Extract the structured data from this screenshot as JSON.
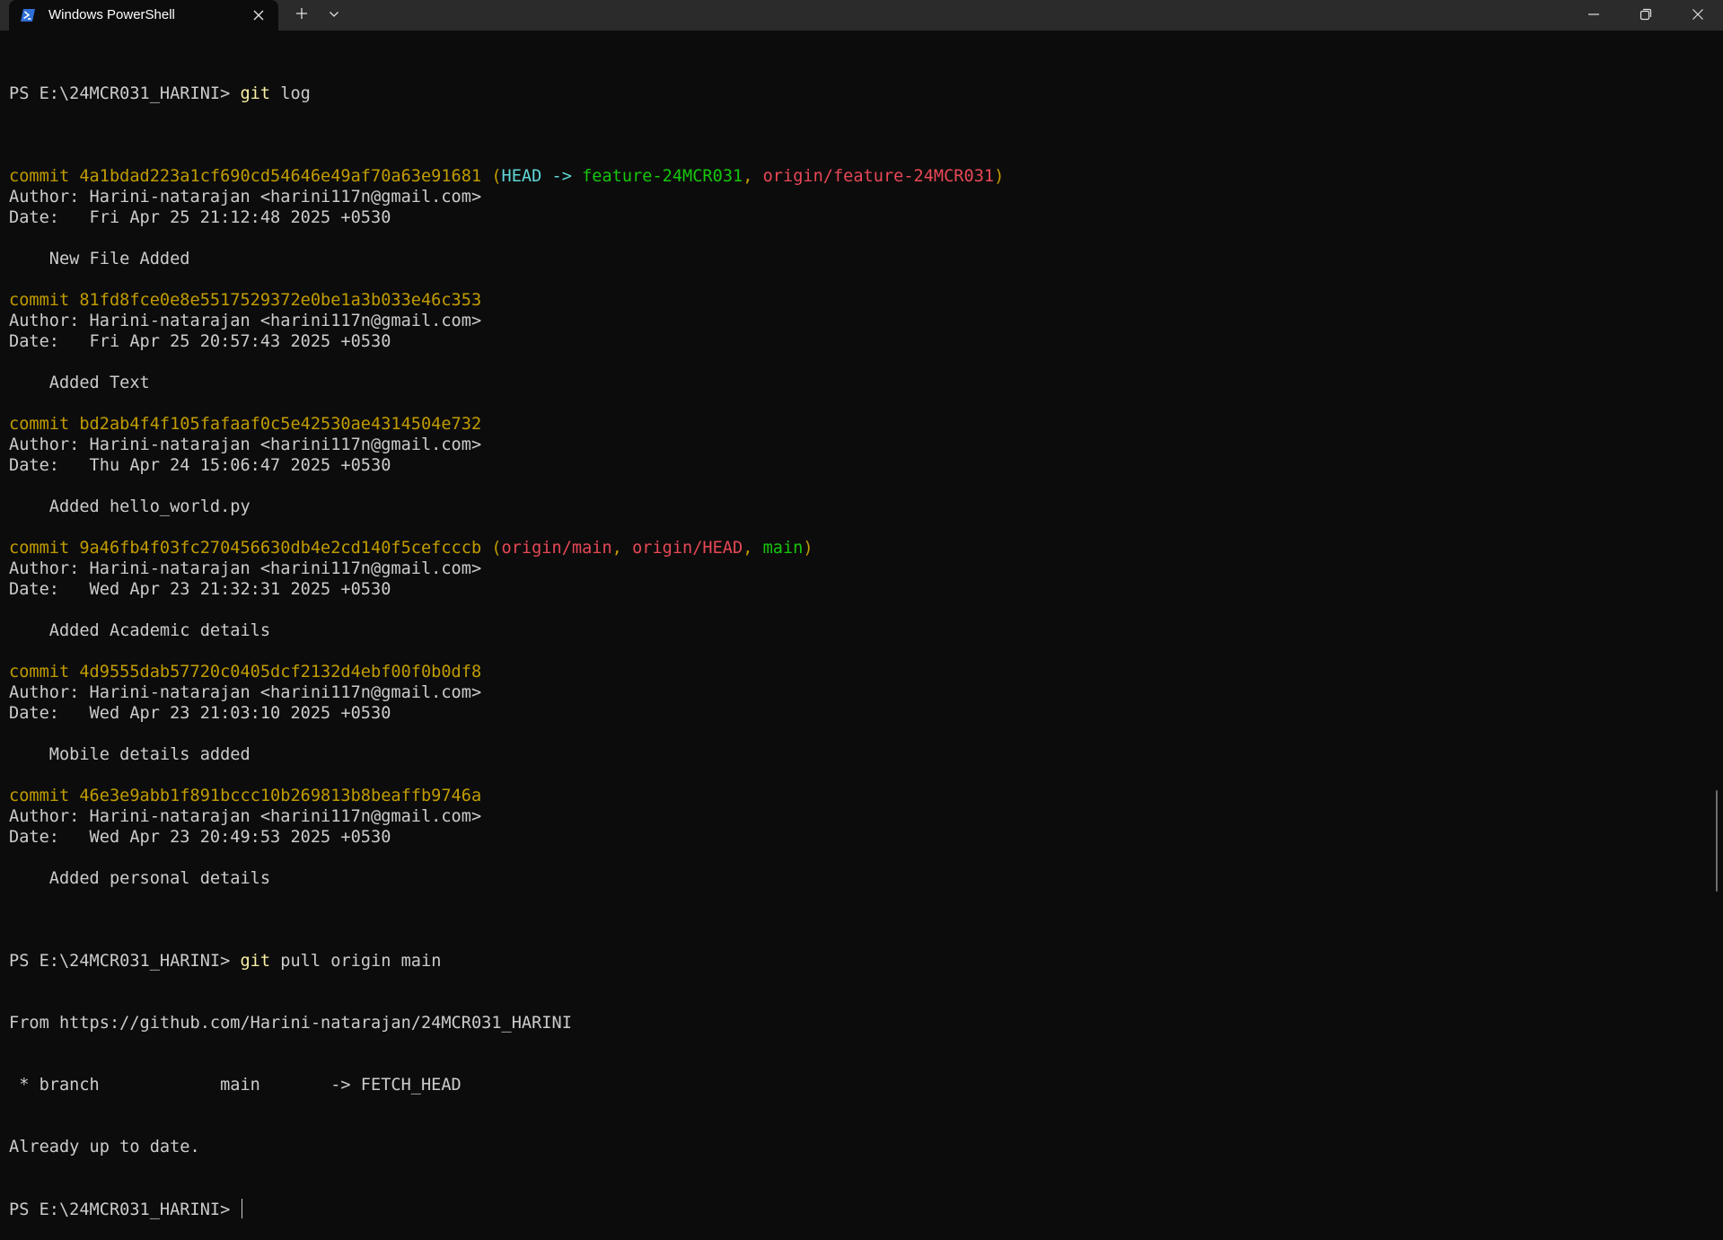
{
  "window": {
    "tab_title": "Windows PowerShell",
    "icons": {
      "app": "powershell-icon",
      "close_tab": "close-icon",
      "new_tab": "plus-icon",
      "dropdown": "chevron-down-icon",
      "minimize": "minimize-icon",
      "maximize": "restore-icon",
      "close_window": "close-icon"
    }
  },
  "colors": {
    "background": "#0c0c0c",
    "titlebar": "#2b2b2b",
    "text": "#cccccc",
    "commit_hash": "#c19c00",
    "head": "#61d6d6",
    "local_branch": "#16c60c",
    "remote_branch": "#e74856",
    "command": "#f9f1a5"
  },
  "terminal": {
    "prompt": "PS E:\\24MCR031_HARINI> ",
    "command_git_log": "git log",
    "commits": [
      {
        "commit": "commit 4a1bdad223a1cf690cd54646e49af70a63e91681",
        "refs": [
          {
            "text": " (",
            "kind": "hash"
          },
          {
            "text": "HEAD -> ",
            "kind": "head"
          },
          {
            "text": "feature-24MCR031",
            "kind": "local"
          },
          {
            "text": ", ",
            "kind": "hash"
          },
          {
            "text": "origin/feature-24MCR031",
            "kind": "remote"
          },
          {
            "text": ")",
            "kind": "hash"
          }
        ],
        "author": "Author: Harini-natarajan <harini117n@gmail.com>",
        "date": "Date:   Fri Apr 25 21:12:48 2025 +0530",
        "message": "    New File Added"
      },
      {
        "commit": "commit 81fd8fce0e8e5517529372e0be1a3b033e46c353",
        "refs": [],
        "author": "Author: Harini-natarajan <harini117n@gmail.com>",
        "date": "Date:   Fri Apr 25 20:57:43 2025 +0530",
        "message": "    Added Text"
      },
      {
        "commit": "commit bd2ab4f4f105fafaaf0c5e42530ae4314504e732",
        "refs": [],
        "author": "Author: Harini-natarajan <harini117n@gmail.com>",
        "date": "Date:   Thu Apr 24 15:06:47 2025 +0530",
        "message": "    Added hello_world.py"
      },
      {
        "commit": "commit 9a46fb4f03fc270456630db4e2cd140f5cefcccb",
        "refs": [
          {
            "text": " (",
            "kind": "hash"
          },
          {
            "text": "origin/main",
            "kind": "remote"
          },
          {
            "text": ", ",
            "kind": "hash"
          },
          {
            "text": "origin/HEAD",
            "kind": "remote"
          },
          {
            "text": ", ",
            "kind": "hash"
          },
          {
            "text": "main",
            "kind": "local"
          },
          {
            "text": ")",
            "kind": "hash"
          }
        ],
        "author": "Author: Harini-natarajan <harini117n@gmail.com>",
        "date": "Date:   Wed Apr 23 21:32:31 2025 +0530",
        "message": "    Added Academic details"
      },
      {
        "commit": "commit 4d9555dab57720c0405dcf2132d4ebf00f0b0df8",
        "refs": [],
        "author": "Author: Harini-natarajan <harini117n@gmail.com>",
        "date": "Date:   Wed Apr 23 21:03:10 2025 +0530",
        "message": "    Mobile details added"
      },
      {
        "commit": "commit 46e3e9abb1f891bccc10b269813b8beaffb9746a",
        "refs": [],
        "author": "Author: Harini-natarajan <harini117n@gmail.com>",
        "date": "Date:   Wed Apr 23 20:49:53 2025 +0530",
        "message": "    Added personal details"
      }
    ],
    "command_git_pull": "git pull origin main",
    "pull_output": [
      "From https://github.com/Harini-natarajan/24MCR031_HARINI",
      " * branch            main       -> FETCH_HEAD",
      "Already up to date."
    ]
  }
}
